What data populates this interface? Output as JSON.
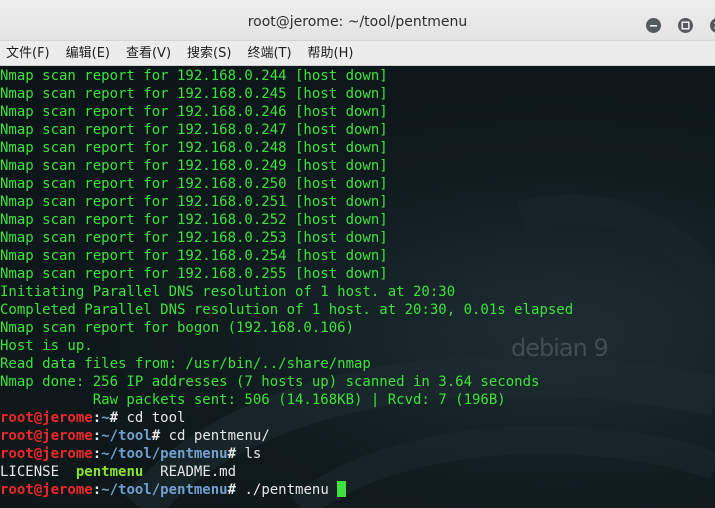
{
  "window": {
    "title": "root@jerome: ~/tool/pentmenu",
    "buttons": {
      "minimize_icon": "minimize-icon",
      "maximize_icon": "maximize-icon",
      "close_icon": "close-icon"
    }
  },
  "menubar": {
    "items": [
      {
        "label": "文件(F)"
      },
      {
        "label": "编辑(E)"
      },
      {
        "label": "查看(V)"
      },
      {
        "label": "搜索(S)"
      },
      {
        "label": "终端(T)"
      },
      {
        "label": "帮助(H)"
      }
    ]
  },
  "terminal": {
    "watermark": "debian 9",
    "colors": {
      "output": "#3fe13f",
      "user": "#ef2929",
      "path": "#729fcf",
      "command": "#e6e6e6",
      "executable": "#8ae234"
    },
    "output_lines": [
      "Nmap scan report for 192.168.0.244 [host down]",
      "Nmap scan report for 192.168.0.245 [host down]",
      "Nmap scan report for 192.168.0.246 [host down]",
      "Nmap scan report for 192.168.0.247 [host down]",
      "Nmap scan report for 192.168.0.248 [host down]",
      "Nmap scan report for 192.168.0.249 [host down]",
      "Nmap scan report for 192.168.0.250 [host down]",
      "Nmap scan report for 192.168.0.251 [host down]",
      "Nmap scan report for 192.168.0.252 [host down]",
      "Nmap scan report for 192.168.0.253 [host down]",
      "Nmap scan report for 192.168.0.254 [host down]",
      "Nmap scan report for 192.168.0.255 [host down]",
      "Initiating Parallel DNS resolution of 1 host. at 20:30",
      "Completed Parallel DNS resolution of 1 host. at 20:30, 0.01s elapsed",
      "Nmap scan report for bogon (192.168.0.106)",
      "Host is up.",
      "Read data files from: /usr/bin/../share/nmap",
      "Nmap done: 256 IP addresses (7 hosts up) scanned in 3.64 seconds",
      "           Raw packets sent: 506 (14.168KB) | Rcvd: 7 (196B)"
    ],
    "prompts": [
      {
        "user": "root@jerome",
        "colon": ":",
        "path": "~",
        "sign": "#",
        "command": " cd tool"
      },
      {
        "user": "root@jerome",
        "colon": ":",
        "path": "~/tool",
        "sign": "#",
        "command": " cd pentmenu/"
      },
      {
        "user": "root@jerome",
        "colon": ":",
        "path": "~/tool/pentmenu",
        "sign": "#",
        "command": " ls"
      }
    ],
    "ls_output": {
      "file1": "LICENSE",
      "gap1": "  ",
      "exec": "pentmenu",
      "gap2": "  ",
      "file2": "README.md"
    },
    "current_prompt": {
      "user": "root@jerome",
      "colon": ":",
      "path": "~/tool/pentmenu",
      "sign": "#",
      "command": " ./pentmenu "
    }
  }
}
